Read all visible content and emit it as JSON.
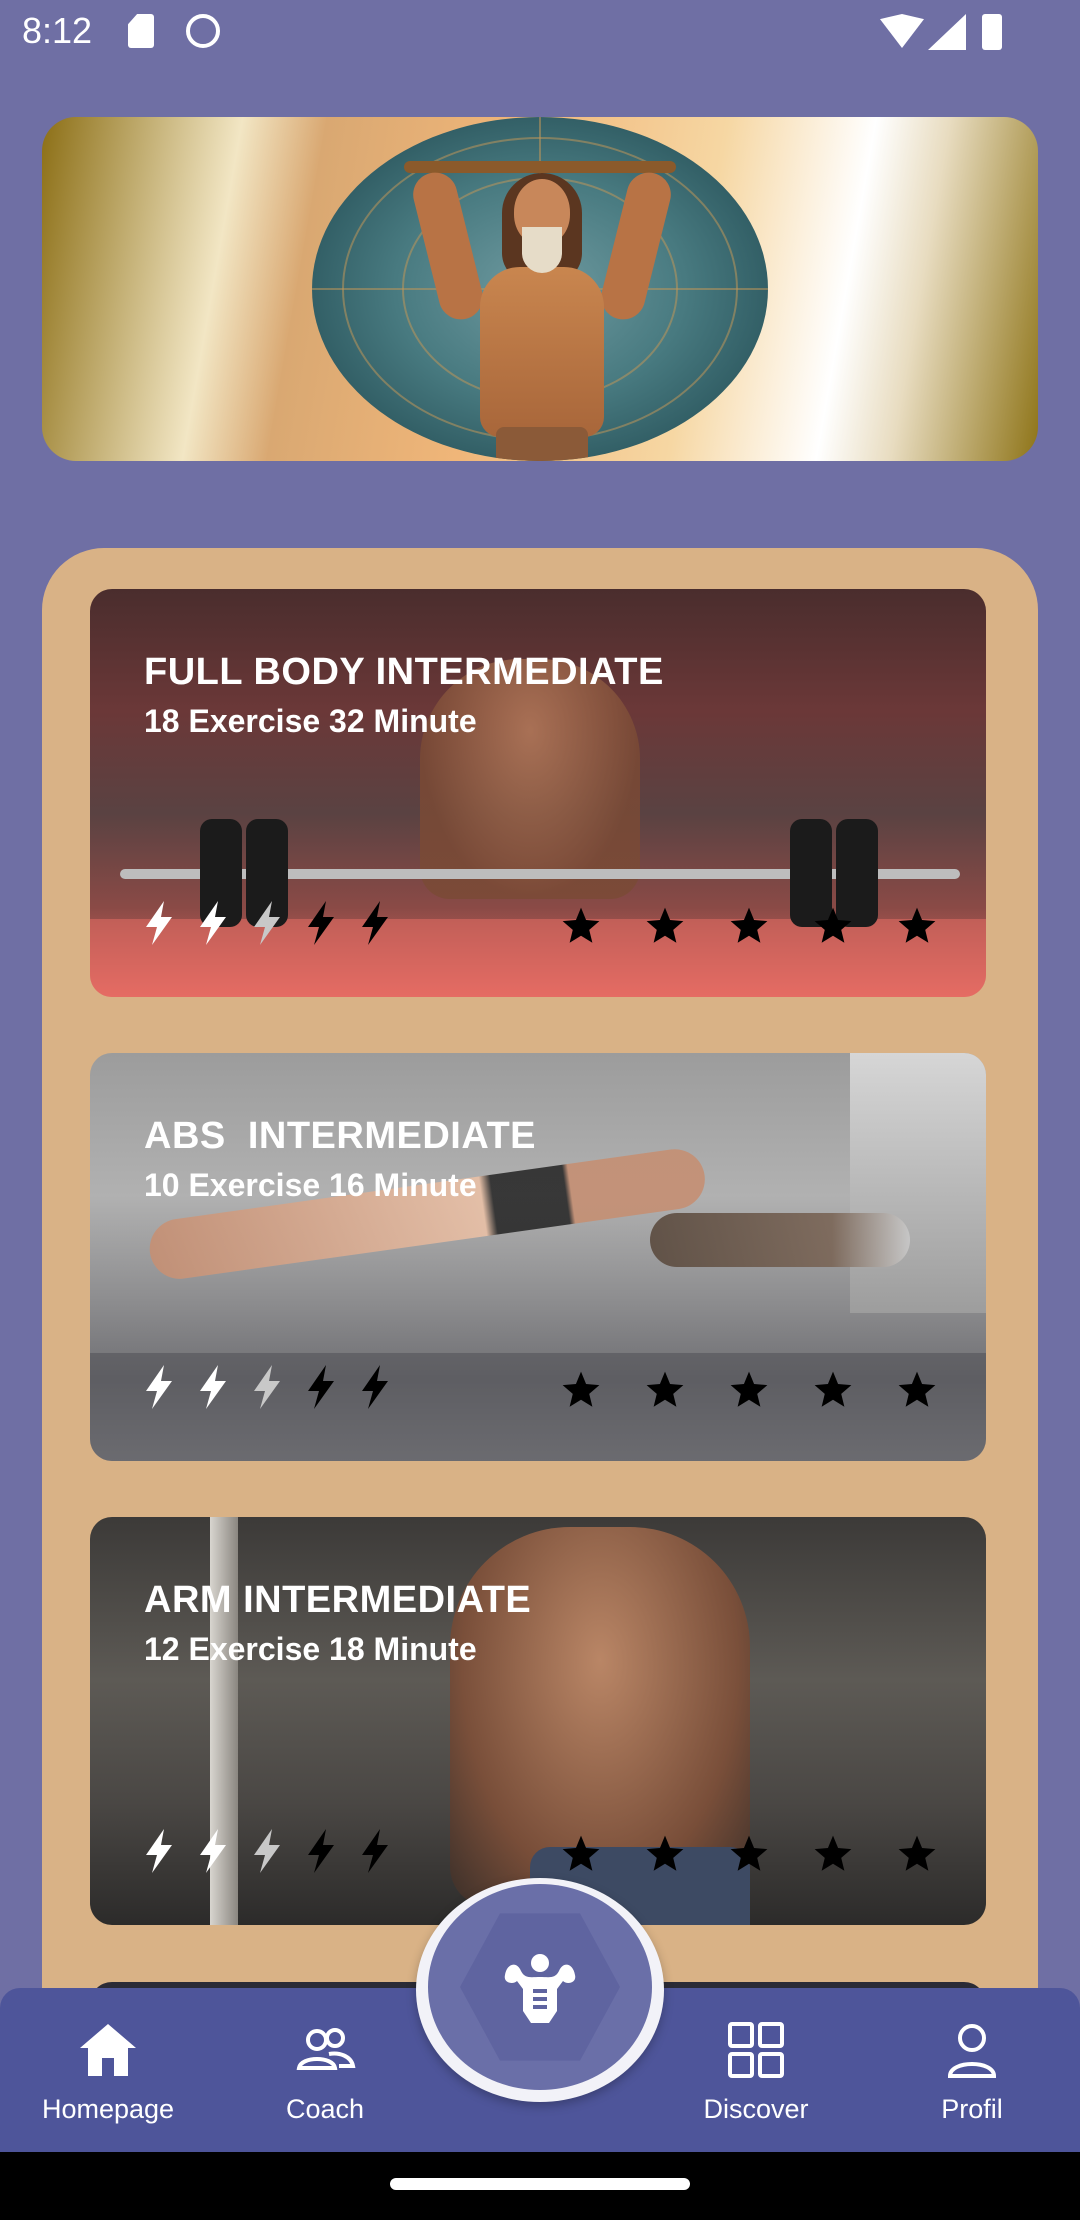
{
  "status_bar": {
    "time": "8:12",
    "icons": [
      "sd-card-icon",
      "cat-icon",
      "wifi-icon",
      "signal-icon",
      "battery-icon"
    ]
  },
  "banner": {
    "image": "muscular-bearded-titan-lifting-bar-medallion"
  },
  "workouts": [
    {
      "title": "FULL BODY INTERMEDIATE",
      "subtitle": "18 Exercise 32 Minute",
      "image": "deadlift-gym-photo",
      "intensity": {
        "white": 2,
        "light_gray": 1,
        "black": 2
      },
      "stars": 5
    },
    {
      "title": "ABS  INTERMEDIATE",
      "subtitle": "10 Exercise 16 Minute",
      "image": "plank-couple-photo",
      "intensity": {
        "white": 2,
        "light_gray": 1,
        "black": 2
      },
      "stars": 5
    },
    {
      "title": "ARM INTERMEDIATE",
      "subtitle": "12 Exercise 18 Minute",
      "image": "cable-curl-bodybuilder-photo",
      "intensity": {
        "white": 2,
        "light_gray": 1,
        "black": 2
      },
      "stars": 5
    }
  ],
  "bottom_nav": {
    "items": [
      {
        "label": "Homepage",
        "icon": "home-icon"
      },
      {
        "label": "Coach",
        "icon": "people-icon"
      },
      {
        "label": "Discover",
        "icon": "grid-icon"
      },
      {
        "label": "Profil",
        "icon": "person-icon"
      }
    ],
    "center_button_icon": "bodybuilder-icon"
  },
  "colors": {
    "background": "#6f6fa4",
    "panel": "#d9b286",
    "nav_bar": "#4e559a",
    "fab": "#6a6fa8"
  }
}
